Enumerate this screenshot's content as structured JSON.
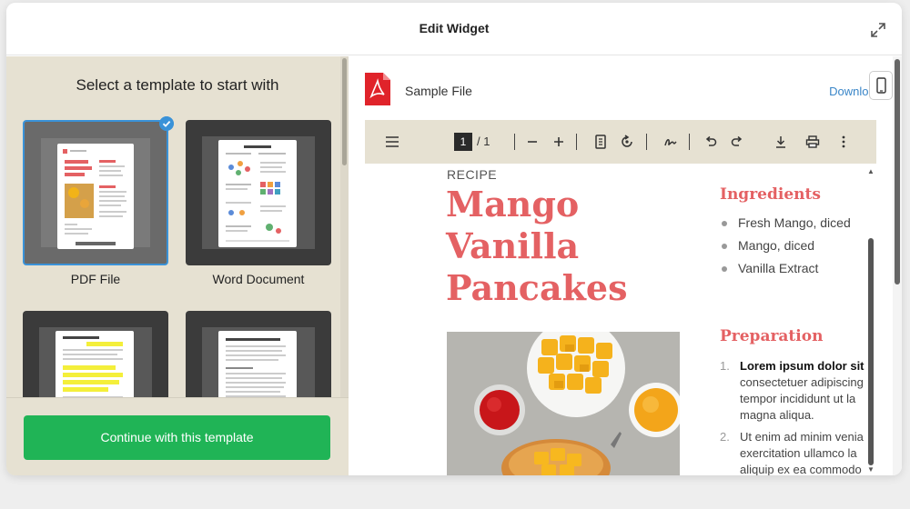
{
  "dialog": {
    "title": "Edit Widget"
  },
  "left": {
    "heading": "Select a template to start with",
    "templates": [
      {
        "label": "PDF File",
        "selected": true
      },
      {
        "label": "Word Document",
        "selected": false
      },
      {
        "label": "",
        "selected": false
      },
      {
        "label": "",
        "selected": false
      }
    ],
    "continue_label": "Continue with this template"
  },
  "right": {
    "file_title": "Sample File",
    "download_label": "Download",
    "toolbar": {
      "current_page": "1",
      "total_pages": "/ 1",
      "icons": [
        "menu-icon",
        "zoom-out-icon",
        "zoom-in-icon",
        "fit-page-icon",
        "rotate-icon",
        "sign-icon",
        "undo-icon",
        "redo-icon",
        "download-icon",
        "print-icon",
        "more-icon"
      ]
    },
    "document": {
      "tag": "RECIPE",
      "title_lines": [
        "Mango",
        "Vanilla",
        "Pancakes"
      ],
      "ingredients_heading": "Ingredients",
      "ingredients": [
        "Fresh Mango, diced",
        "Mango, diced",
        "Vanilla Extract"
      ],
      "preparation_heading": "Preparation",
      "steps": [
        {
          "num": "1.",
          "bold": "Lorem ipsum dolor sit a",
          "lines": [
            "consectetuer adipiscing",
            "tempor incididunt ut la",
            "magna aliqua."
          ]
        },
        {
          "num": "2.",
          "bold": "",
          "lines": [
            "Ut enim ad minim venia",
            "exercitation ullamco la",
            "aliquip ex ea commodo"
          ]
        }
      ]
    }
  },
  "colors": {
    "accent_blue": "#3a92d8",
    "continue_green": "#20b456",
    "recipe_red": "#e46163",
    "panel_beige": "#e6e1d2"
  }
}
